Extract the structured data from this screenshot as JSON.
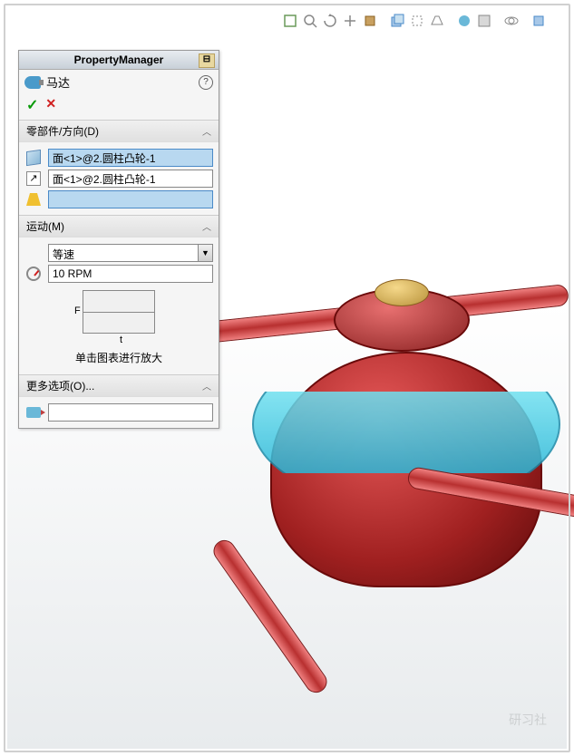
{
  "panel": {
    "title": "PropertyManager",
    "feature_name": "马达",
    "sections": {
      "direction": {
        "label": "零部件/方向(D)",
        "face_field": "面<1>@2.圆柱凸轮-1",
        "direction_field": "面<1>@2.圆柱凸轮-1",
        "origin_field": ""
      },
      "motion": {
        "label": "运动(M)",
        "type": "等速",
        "speed": "10 RPM",
        "graph_y": "F",
        "graph_x": "t",
        "hint": "单击图表进行放大"
      },
      "options": {
        "label": "更多选项(O)...",
        "field": ""
      }
    }
  },
  "watermark": "研习社"
}
